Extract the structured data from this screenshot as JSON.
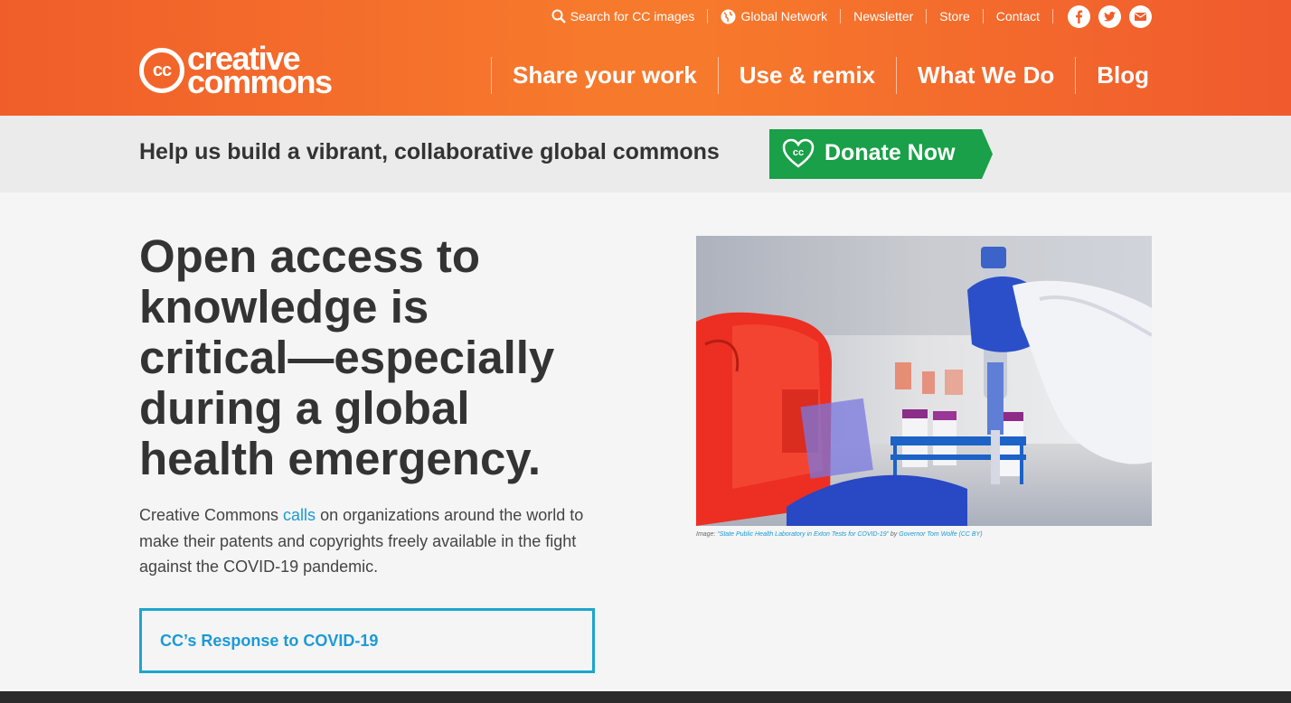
{
  "topbar": {
    "search": "Search for CC images",
    "global": "Global Network",
    "newsletter": "Newsletter",
    "store": "Store",
    "contact": "Contact"
  },
  "logo": {
    "mark": "cc",
    "line1": "creative",
    "line2": "commons"
  },
  "nav": {
    "share": "Share your work",
    "use": "Use & remix",
    "what": "What We Do",
    "blog": "Blog"
  },
  "band": {
    "help": "Help us build a vibrant, collaborative global commons",
    "donate": "Donate Now"
  },
  "hero": {
    "line1": "Open access to",
    "line2": "knowledge is",
    "line3": "critical—especially",
    "line4": "during a global",
    "line5": "health emergency.",
    "p_before": "Creative Commons ",
    "p_link": "calls",
    "p_after": " on organizations around the world to make their patents and copyrights freely available in the fight against the COVID-19 pandemic.",
    "button": "CC’s Response to COVID-19"
  },
  "caption": {
    "prefix": "Image: ",
    "title": "“State Public Health Laboratory in Exton Tests for COVID-19”",
    "by": " by ",
    "author": "Governor Tom Wolfe (CC BY)"
  },
  "colors": {
    "orange": "#f7792c",
    "green": "#1aa048",
    "link": "#1a9ad6",
    "text": "#333333"
  },
  "icons": [
    "search-icon",
    "globe-icon",
    "facebook-icon",
    "twitter-icon",
    "mail-icon",
    "cc-heart-icon"
  ]
}
